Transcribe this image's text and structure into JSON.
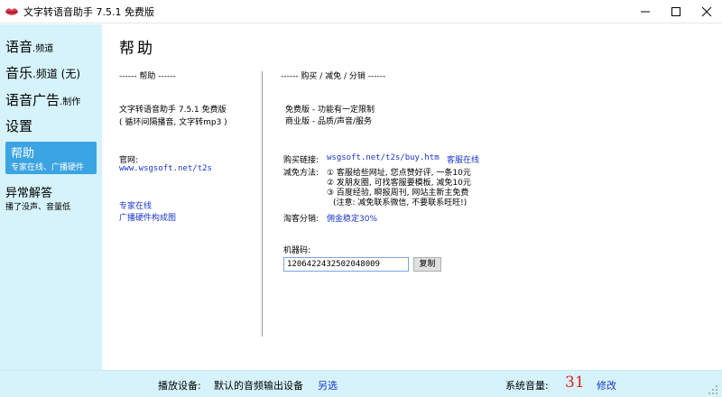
{
  "window": {
    "title": "文字转语音助手 7.5.1 免费版",
    "controls": {
      "minimize": "minimize",
      "maximize": "maximize",
      "close": "close"
    }
  },
  "sidebar": {
    "voice_main": "语音",
    "voice_sub": ".频道",
    "music_main": "音乐",
    "music_sub": ".频道 (无)",
    "ad_main": "语音广告",
    "ad_sub": ".制作",
    "settings": "设置",
    "help_title": "帮助",
    "help_sub": "专家在线、广播硬件",
    "faq_title": "异常解答",
    "faq_sub": "播了没声、音量低"
  },
  "main": {
    "title": "帮助",
    "left": {
      "header": "------  帮助  ------",
      "app_line": "文字转语音助手 7.5.1 免费版",
      "app_desc": "( 循环间隔播音, 文字转mp3 )",
      "site_label": "官网:",
      "site_url": "www.wsgsoft.net/t2s",
      "expert_link": "专家在线",
      "hardware_link": "广播硬件构成图"
    },
    "right": {
      "header": "------  购买 / 减免 / 分销  ------",
      "free_edition": "免费版 - 功能有一定限制",
      "commercial_edition": "商业版 - 品质/声音/服务",
      "buy_label": "购买链接:",
      "buy_url": "wsgsoft.net/t2s/buy.htm",
      "service_link": "客服在线",
      "discount_label": "减免方法:",
      "discount_1": "① 客服给些网址, 您点赞好评, 一条10元",
      "discount_2": "② 发朋友圈, 可找客服要模板, 减免10元",
      "discount_3": "③ 百度经验, 瞬报周刊, 网站主新主免费",
      "discount_note": "(注意: 减免联系微信, 不要联系旺旺!)",
      "taobao_label": "淘客分销:",
      "taobao_link": "佣金稳定30%",
      "machine_code_label": "机器码:",
      "machine_code_value": "1206422432502048009",
      "copy_button": "复制"
    }
  },
  "status": {
    "device_label": "播放设备:",
    "device_value": "默认的音频输出设备",
    "device_change": "另选",
    "volume_label": "系统音量:",
    "volume_value": "31",
    "volume_edit": "修改"
  },
  "colors": {
    "sidebar_bg": "#d6f3fb",
    "active_item_bg": "#3ba4e3",
    "link": "#1a35c9",
    "volume": "#e02020"
  }
}
